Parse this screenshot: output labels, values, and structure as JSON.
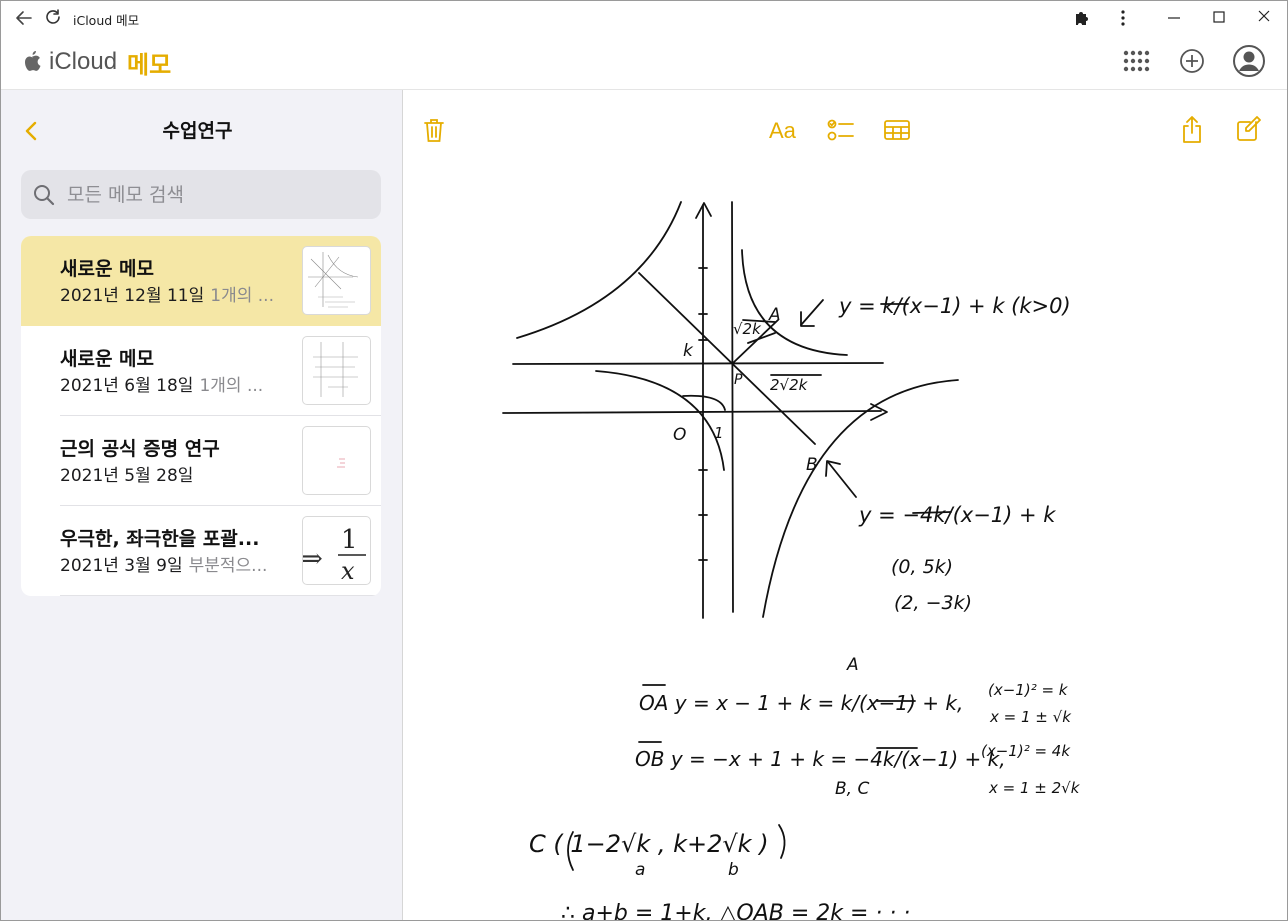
{
  "window": {
    "title": "iCloud 메모"
  },
  "header": {
    "brand": "iCloud",
    "section": "메모"
  },
  "sidebar": {
    "folder_title": "수업연구",
    "search": {
      "placeholder": "모든 메모 검색",
      "value": ""
    },
    "notes": [
      {
        "title": "새로운 메모",
        "date": "2021년 12월 11일",
        "preview": "1개의 ...",
        "selected": true
      },
      {
        "title": "새로운 메모",
        "date": "2021년 6월 18일",
        "preview": "1개의 ...",
        "selected": false
      },
      {
        "title": "근의 공식 증명 연구",
        "date": "2021년 5월 28일",
        "preview": "",
        "selected": false
      },
      {
        "title": "우극한, 좌극한을 포괄...",
        "date": "2021년 3월 9일",
        "preview": "부분적으...",
        "selected": false
      }
    ]
  },
  "toolbar": {
    "format_label": "Aa"
  },
  "note": {
    "origin_label": "O",
    "one_label": "1",
    "k_label": "k",
    "p_label": "P",
    "a_label": "A",
    "b_label": "B",
    "sqrt2k_label": "√2k",
    "two_sqrt2k_label": "2√2k",
    "curve1": "y = k/(x−1) + k (k>0)",
    "curve2": "y = −4k/(x−1) + k",
    "point1": "(0, 5k)",
    "point2": "(2, −3k)",
    "a_top": "A",
    "line_oa": "OA  y = x − 1 + k  =  k/(x−1) + k,",
    "eq_oa1": "(x−1)² = k",
    "eq_oa2": "x = 1 ± √k",
    "line_ob": "OB  y = −x + 1 + k  =  −4k/(x−1) + k,",
    "eq_ob1": "(x−1)² = 4k",
    "eq_ob2": "x = 1 ± 2√k",
    "bc_label": "B, C",
    "c_point": "C ( 1−2√k ,  k+2√k )",
    "c_a": "a",
    "c_b": "b",
    "last_line": "∴  a+b = 1+k,  △OAB = 2k  =  · · ·"
  },
  "colors": {
    "accent": "#e5ad00",
    "selected_bg": "#f5e7a6",
    "sidebar_bg": "#f2f2f7"
  }
}
